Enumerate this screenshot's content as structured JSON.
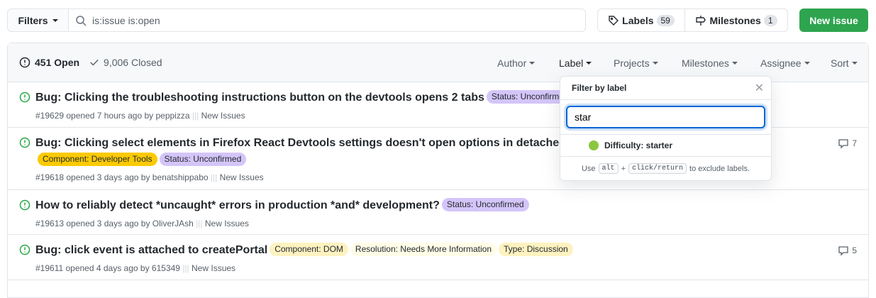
{
  "filters": {
    "button_label": "Filters",
    "search_value": "is:issue is:open"
  },
  "labels_button": {
    "label": "Labels",
    "count": "59"
  },
  "milestones_button": {
    "label": "Milestones",
    "count": "1"
  },
  "new_issue_label": "New issue",
  "states": {
    "open": "451 Open",
    "closed": "9,006 Closed"
  },
  "header_filters": [
    "Author",
    "Label",
    "Projects",
    "Milestones",
    "Assignee",
    "Sort"
  ],
  "issues": [
    {
      "title": "Bug: Clicking the troubleshooting instructions button on the devtools opens 2 tabs",
      "labels": [
        {
          "text": "Status: Unconfirmed",
          "color": "#d4c5f9"
        }
      ],
      "meta": "#19629 opened 7 hours ago by peppizza",
      "project": "New Issues",
      "comments": ""
    },
    {
      "title": "Bug: Clicking select elements in Firefox React Devtools settings doesn't open options in detached Firefox Dev Tools window",
      "labels": [
        {
          "text": "Component: Developer Tools",
          "color": "#fbca04"
        },
        {
          "text": "Status: Unconfirmed",
          "color": "#d4c5f9"
        }
      ],
      "meta": "#19618 opened 3 days ago by benatshippabo",
      "project": "New Issues",
      "comments": "7"
    },
    {
      "title": "How to reliably detect *uncaught* errors in production *and* development?",
      "labels": [
        {
          "text": "Status: Unconfirmed",
          "color": "#d4c5f9"
        }
      ],
      "meta": "#19613 opened 3 days ago by OliverJAsh",
      "project": "New Issues",
      "comments": ""
    },
    {
      "title": "Bug: click event is attached to createPortal",
      "labels": [
        {
          "text": "Component: DOM",
          "color": "#fef2c0"
        },
        {
          "text": "Resolution: Needs More Information",
          "color": "#fffde7"
        },
        {
          "text": "Type: Discussion",
          "color": "#fef2c0"
        }
      ],
      "meta": "#19611 opened 4 days ago by 615349",
      "project": "New Issues",
      "comments": "5"
    }
  ],
  "label_dropdown": {
    "title": "Filter by label",
    "search_value": "star",
    "items": [
      {
        "text": "Difficulty: starter",
        "color": "#8cc63f"
      }
    ],
    "footer": {
      "use": "Use",
      "alt": "alt",
      "plus": "+",
      "click": "click/return",
      "rest": "to exclude labels."
    }
  }
}
